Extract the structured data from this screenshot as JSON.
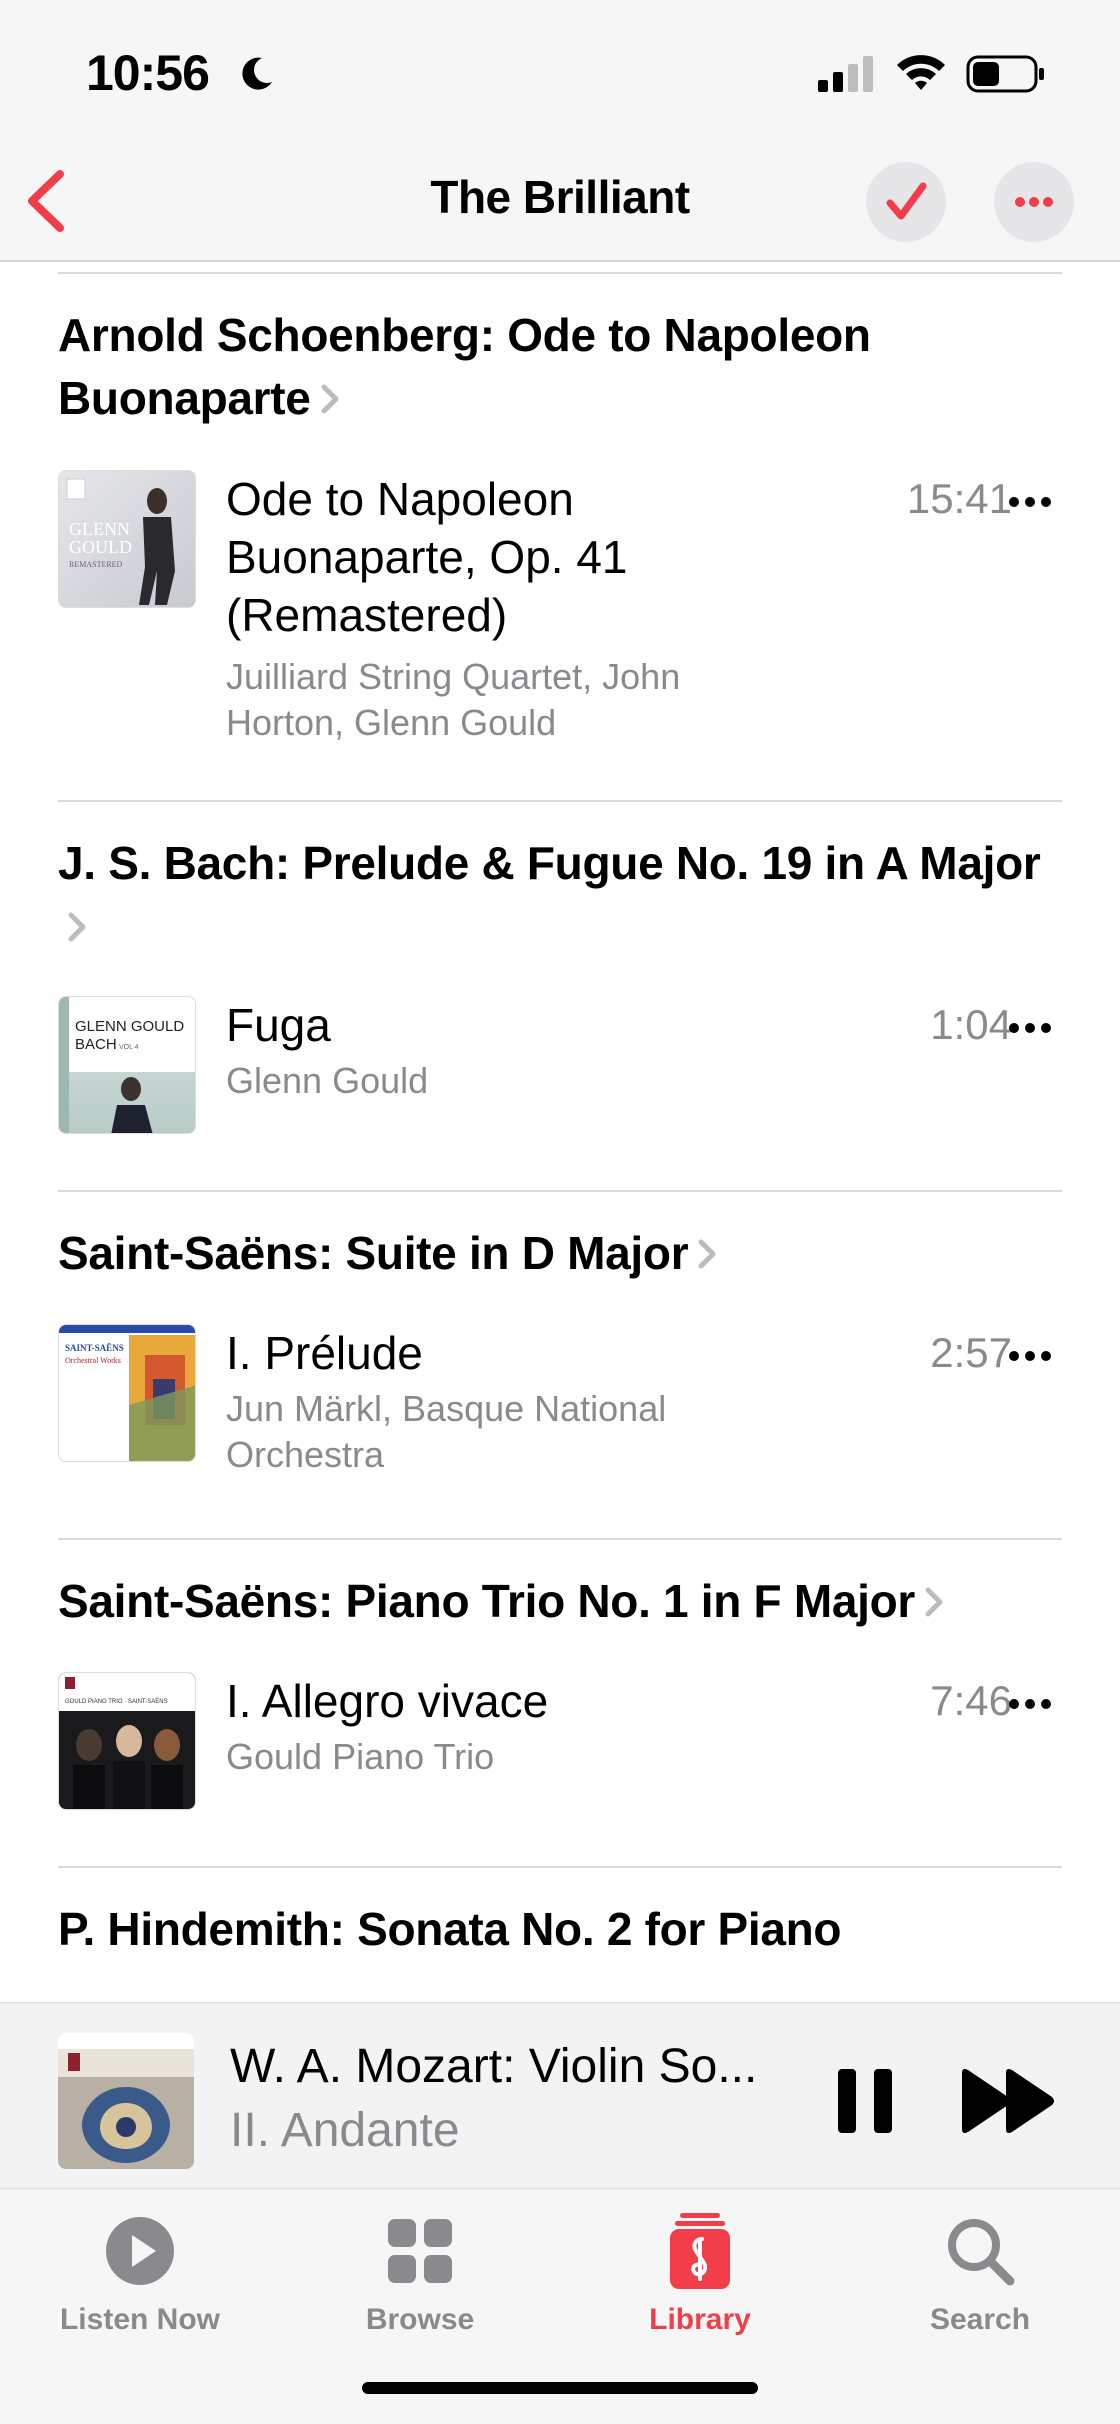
{
  "status_bar": {
    "time": "10:56"
  },
  "nav": {
    "title": "The Brilliant",
    "back_icon": "chevron-left-icon",
    "check_icon": "checkmark-icon",
    "more_icon": "ellipsis-icon",
    "accent_color": "#f23d4b"
  },
  "sections": [
    {
      "title": "Arnold Schoenberg: Ode to Napoleon Buonaparte",
      "tracks": [
        {
          "title": "Ode to Napoleon Buonaparte, Op. 41 (Remastered)",
          "artist": "Juilliard String Quartet, John Horton, Glenn Gould",
          "duration": "15:41"
        }
      ]
    },
    {
      "title": "J. S. Bach: Prelude & Fugue No. 19 in A Major",
      "tracks": [
        {
          "title": "Fuga",
          "artist": "Glenn Gould",
          "duration": "1:04"
        }
      ]
    },
    {
      "title": "Saint-Saëns: Suite in D Major",
      "tracks": [
        {
          "title": "I. Prélude",
          "artist": "Jun Märkl, Basque National Orchestra",
          "duration": "2:57"
        }
      ]
    },
    {
      "title": "Saint-Saëns: Piano Trio No. 1 in F Major",
      "tracks": [
        {
          "title": "I. Allegro vivace",
          "artist": "Gould Piano Trio",
          "duration": "7:46"
        }
      ]
    },
    {
      "title": "P. Hindemith: Sonata No. 2 for Piano",
      "tracks": []
    }
  ],
  "album_art": {
    "gould_remastered": {
      "line1": "GLENN",
      "line2": "GOULD",
      "line3": "REMASTERED"
    },
    "gould_bach": {
      "line1": "GLENN GOULD",
      "line2": "BACH",
      "line3": "VOL 4"
    },
    "saint_saens": {
      "line1": "SAINT-SAËNS",
      "line2": "Orchestral Works"
    },
    "piano_trio": {
      "line1": "GOULD PIANO TRIO · SAINT-SAËNS"
    }
  },
  "now_playing": {
    "title": "W. A. Mozart: Violin So...",
    "subtitle": "II. Andante",
    "pause_icon": "pause-icon",
    "forward_icon": "fast-forward-icon"
  },
  "tab_bar": {
    "tabs": [
      {
        "label": "Listen Now",
        "icon": "play-circle-icon",
        "active": false
      },
      {
        "label": "Browse",
        "icon": "grid-icon",
        "active": false
      },
      {
        "label": "Library",
        "icon": "library-icon",
        "active": true
      },
      {
        "label": "Search",
        "icon": "search-icon",
        "active": false
      }
    ]
  }
}
